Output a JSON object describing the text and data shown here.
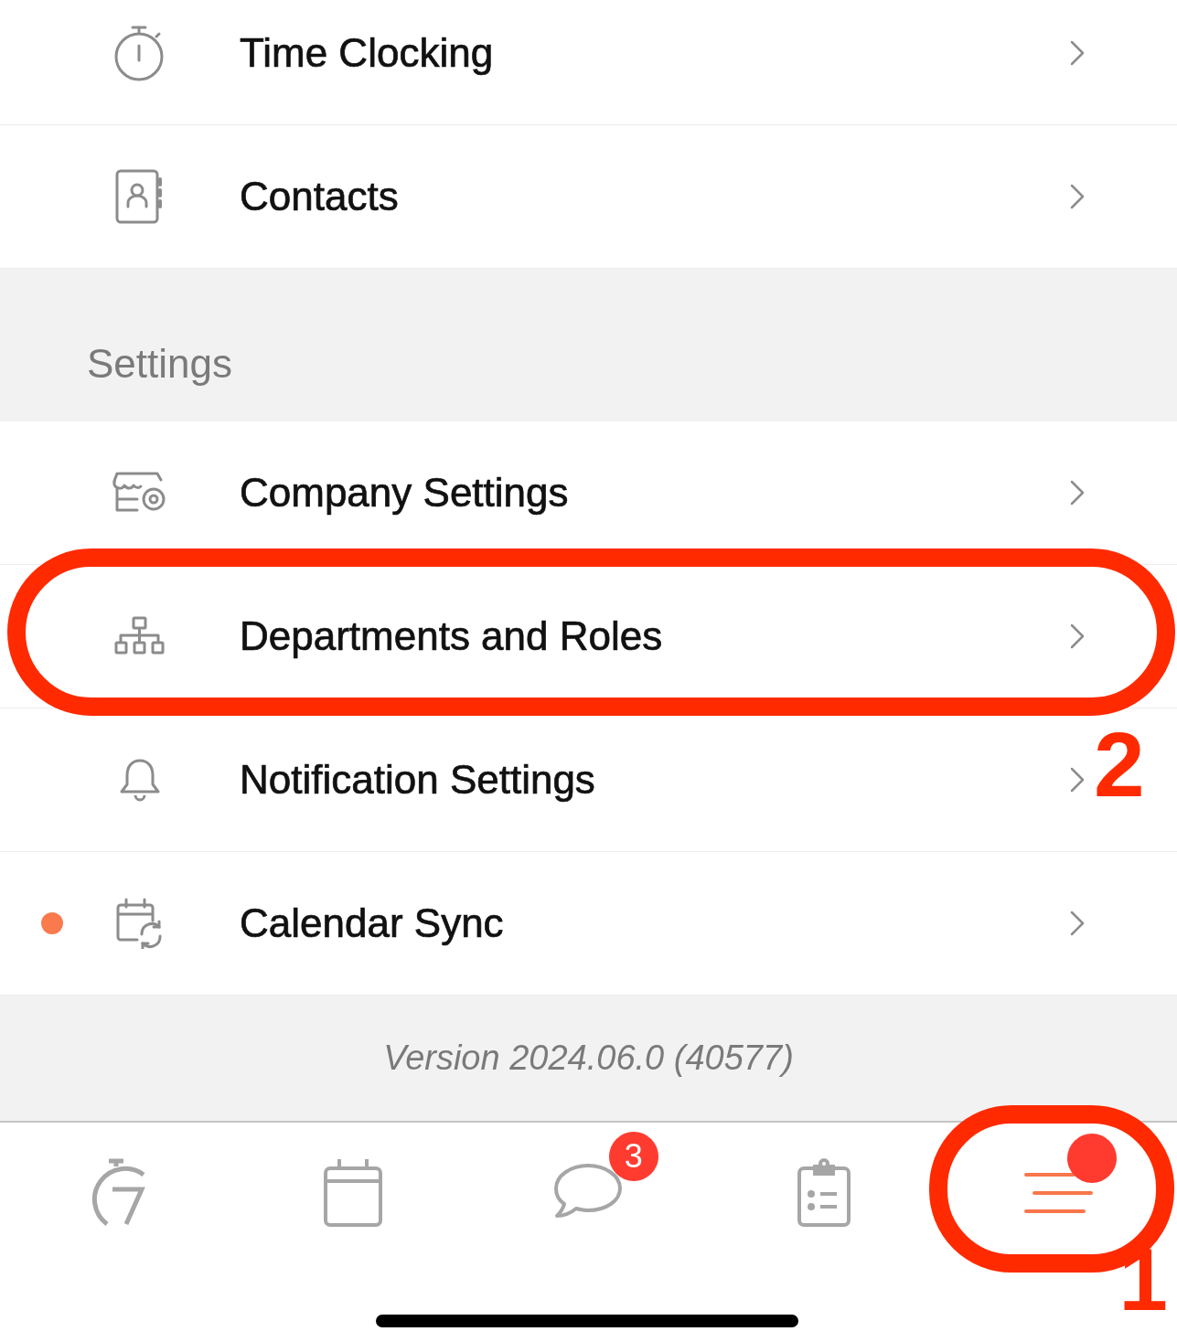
{
  "menu_rows": [
    {
      "label": "Time Clocking",
      "new_indicator": false
    },
    {
      "label": "Contacts",
      "new_indicator": false
    }
  ],
  "settings": {
    "title": "Settings",
    "rows": [
      {
        "label": "Company Settings",
        "new_indicator": false
      },
      {
        "label": "Departments and Roles",
        "new_indicator": false,
        "callout": "2"
      },
      {
        "label": "Notification Settings",
        "new_indicator": false
      },
      {
        "label": "Calendar Sync",
        "new_indicator": true
      }
    ]
  },
  "version": "Version 2024.06.0 (40577)",
  "tabs": [
    {
      "selected": false
    },
    {
      "selected": false
    },
    {
      "selected": false,
      "badge": "3"
    },
    {
      "selected": false
    },
    {
      "selected": true,
      "dot": true,
      "callout": "1"
    }
  ]
}
